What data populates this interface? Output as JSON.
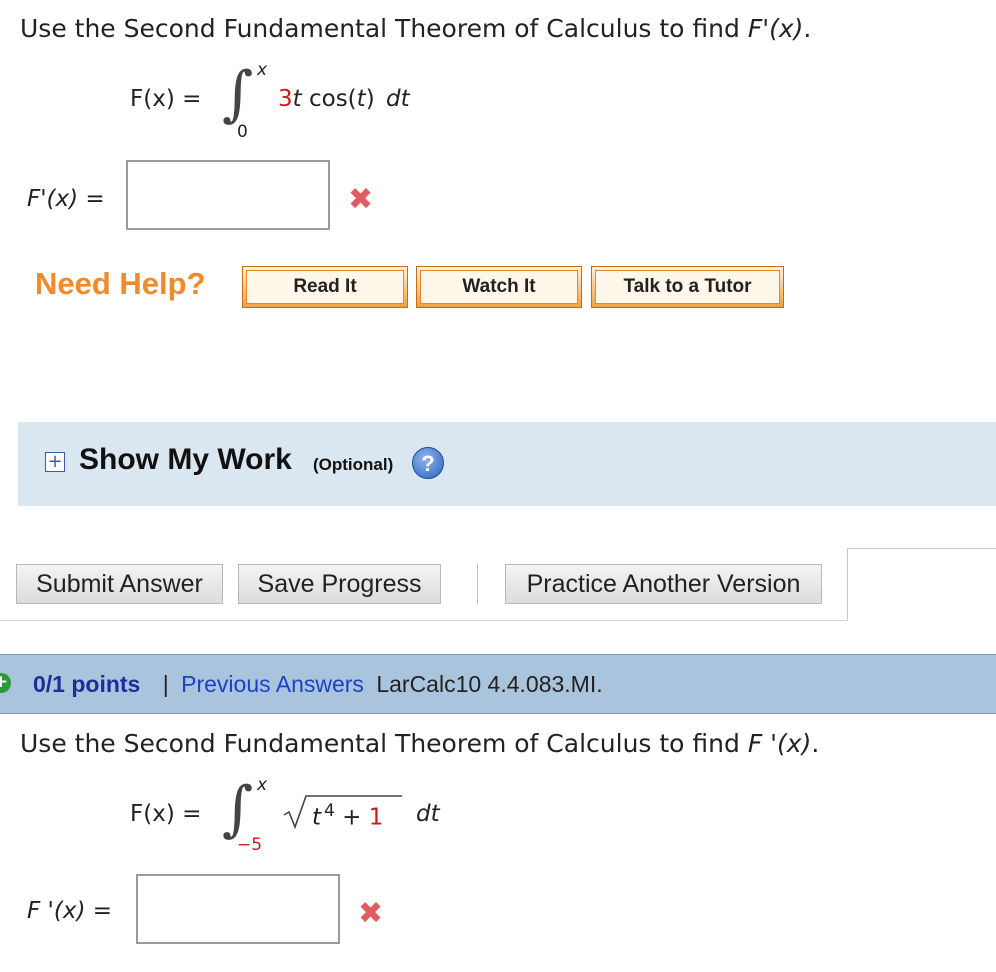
{
  "q1": {
    "prompt_prefix": "Use the Second Fundamental Theorem of Calculus to find ",
    "prompt_func": "F'(x)",
    "prompt_suffix": ".",
    "lhs": "F(x) =",
    "upper_limit": "x",
    "lower_limit": "0",
    "integrand_coef": "3",
    "integrand_rest_1": "t",
    "integrand_rest_2": " cos(",
    "integrand_rest_3": "t",
    "integrand_rest_4": ")",
    "dt": "dt",
    "answer_label": "F'(x) =",
    "answer_value": "",
    "status_icon": "incorrect-x"
  },
  "help": {
    "label": "Need Help?",
    "buttons": [
      "Read It",
      "Watch It",
      "Talk to a Tutor"
    ]
  },
  "show_my_work": {
    "title": "Show My Work",
    "optional": "(Optional)",
    "help_glyph": "?"
  },
  "actions": {
    "submit": "Submit Answer",
    "save": "Save Progress",
    "practice": "Practice Another Version"
  },
  "q2_header": {
    "points": "0/1 points",
    "separator": "|",
    "previous_answers": "Previous Answers",
    "source": "LarCalc10 4.4.083.MI."
  },
  "q2": {
    "prompt_prefix": "Use the Second Fundamental Theorem of Calculus to find ",
    "prompt_func": "F '(x)",
    "prompt_suffix": ".",
    "lhs": "F(x) =",
    "upper_limit": "x",
    "lower_limit": "−5",
    "radicand_t": "t",
    "radicand_exp": "4",
    "radicand_plus": " + ",
    "radicand_const": "1",
    "dt": "dt",
    "answer_label": "F '(x) =",
    "answer_value": "",
    "status_icon": "incorrect-x"
  },
  "colors": {
    "need_help": "#f08a2a",
    "incorrect": "#e15c60",
    "link": "#1b42c4",
    "panel": "#dae6f0",
    "question_bar": "#a9c4dc"
  }
}
